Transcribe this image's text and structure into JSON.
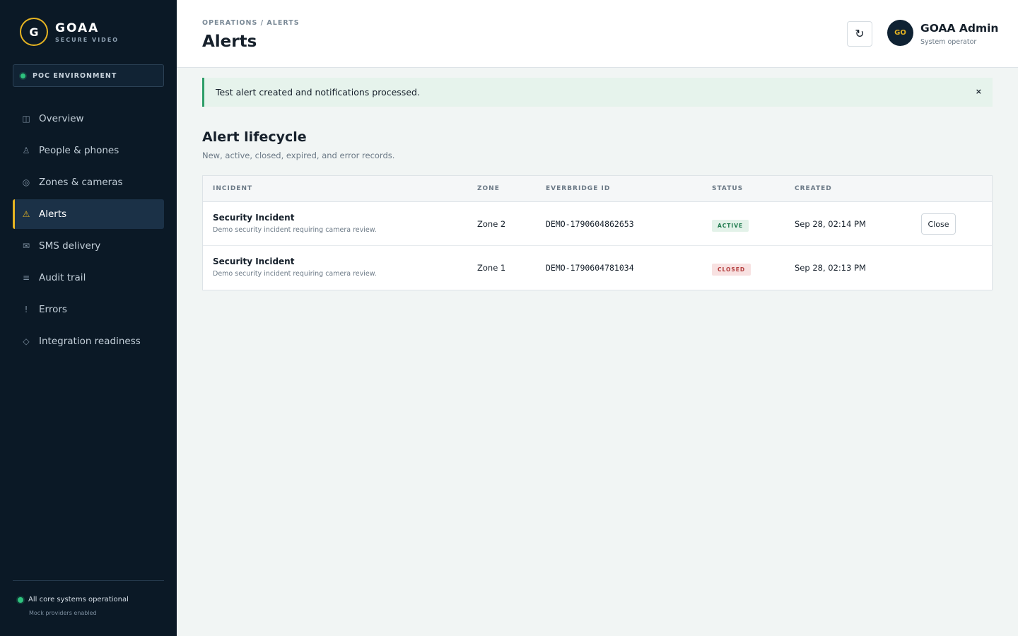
{
  "brand": {
    "logo_letter": "G",
    "name": "GOAA",
    "subtitle": "SECURE VIDEO"
  },
  "environment": {
    "label": "POC ENVIRONMENT"
  },
  "sidebar": {
    "items": [
      {
        "icon": "◫",
        "icon_name": "overview-icon",
        "label": "Overview"
      },
      {
        "icon": "♙",
        "icon_name": "person-icon",
        "label": "People & phones"
      },
      {
        "icon": "◎",
        "icon_name": "camera-icon",
        "label": "Zones & cameras"
      },
      {
        "icon": "⚠",
        "icon_name": "warning-icon",
        "label": "Alerts"
      },
      {
        "icon": "✉",
        "icon_name": "envelope-icon",
        "label": "SMS delivery"
      },
      {
        "icon": "≡",
        "icon_name": "list-icon",
        "label": "Audit trail"
      },
      {
        "icon": "!",
        "icon_name": "exclamation-icon",
        "label": "Errors"
      },
      {
        "icon": "◇",
        "icon_name": "diamond-icon",
        "label": "Integration readiness"
      }
    ],
    "active": "Alerts",
    "status_text": "All core systems operational",
    "status_sub": "Mock providers enabled"
  },
  "header": {
    "breadcrumb": "OPERATIONS / ALERTS",
    "title": "Alerts",
    "refresh_icon": "↻",
    "avatar_initials": "GO",
    "user_name": "GOAA Admin",
    "user_role": "System operator"
  },
  "banner": {
    "message": "Test alert created and notifications processed.",
    "close": "×"
  },
  "section": {
    "title": "Alert lifecycle",
    "subtitle": "New, active, closed, expired, and error records."
  },
  "table": {
    "columns": [
      "INCIDENT",
      "ZONE",
      "EVERBRIDGE ID",
      "STATUS",
      "CREATED"
    ],
    "rows": [
      {
        "title": "Security Incident",
        "description": "Demo security incident requiring camera review.",
        "zone": "Zone 2",
        "everbridge_id": "DEMO-1790604862653",
        "status": "ACTIVE",
        "created": "Sep 28, 02:14 PM",
        "action": "Close"
      },
      {
        "title": "Security Incident",
        "description": "Demo security incident requiring camera review.",
        "zone": "Zone 1",
        "everbridge_id": "DEMO-1790604781034",
        "status": "CLOSED",
        "created": "Sep 28, 02:13 PM",
        "action": ""
      }
    ]
  },
  "colors": {
    "sidebar_bg": "#0b1926",
    "accent": "#e6b422",
    "success": "#2ec27e",
    "active_badge": "#1f7a4d",
    "closed_badge": "#b23a3a"
  }
}
